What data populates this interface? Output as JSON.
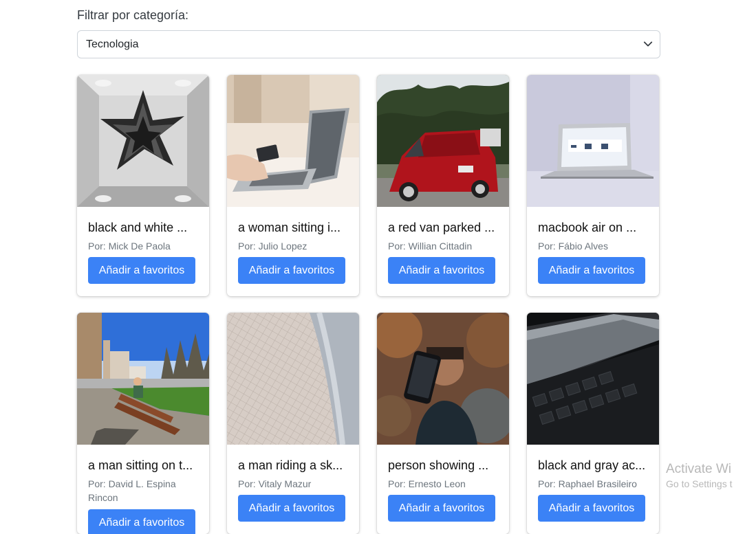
{
  "filter": {
    "label": "Filtrar por categoría:",
    "selected": "Tecnologia"
  },
  "cards": [
    {
      "title": "black and white ...",
      "author": "Por: Mick De Paola",
      "button": "Añadir a favoritos"
    },
    {
      "title": "a woman sitting i...",
      "author": "Por: Julio Lopez",
      "button": "Añadir a favoritos"
    },
    {
      "title": "a red van parked ...",
      "author": "Por: Willian Cittadin",
      "button": "Añadir a favoritos"
    },
    {
      "title": "macbook air on ...",
      "author": "Por: Fábio Alves",
      "button": "Añadir a favoritos"
    },
    {
      "title": "a man sitting on t...",
      "author": "Por: David L. Espina Rincon",
      "button": "Añadir a favoritos"
    },
    {
      "title": "a man riding a sk...",
      "author": "Por: Vitaly Mazur",
      "button": "Añadir a favoritos"
    },
    {
      "title": "person showing ...",
      "author": "Por: Ernesto Leon",
      "button": "Añadir a favoritos"
    },
    {
      "title": "black and gray ac...",
      "author": "Por: Raphael Brasileiro",
      "button": "Añadir a favoritos"
    }
  ],
  "watermark": {
    "line1": "Activate Wi",
    "line2": "Go to Settings t"
  }
}
